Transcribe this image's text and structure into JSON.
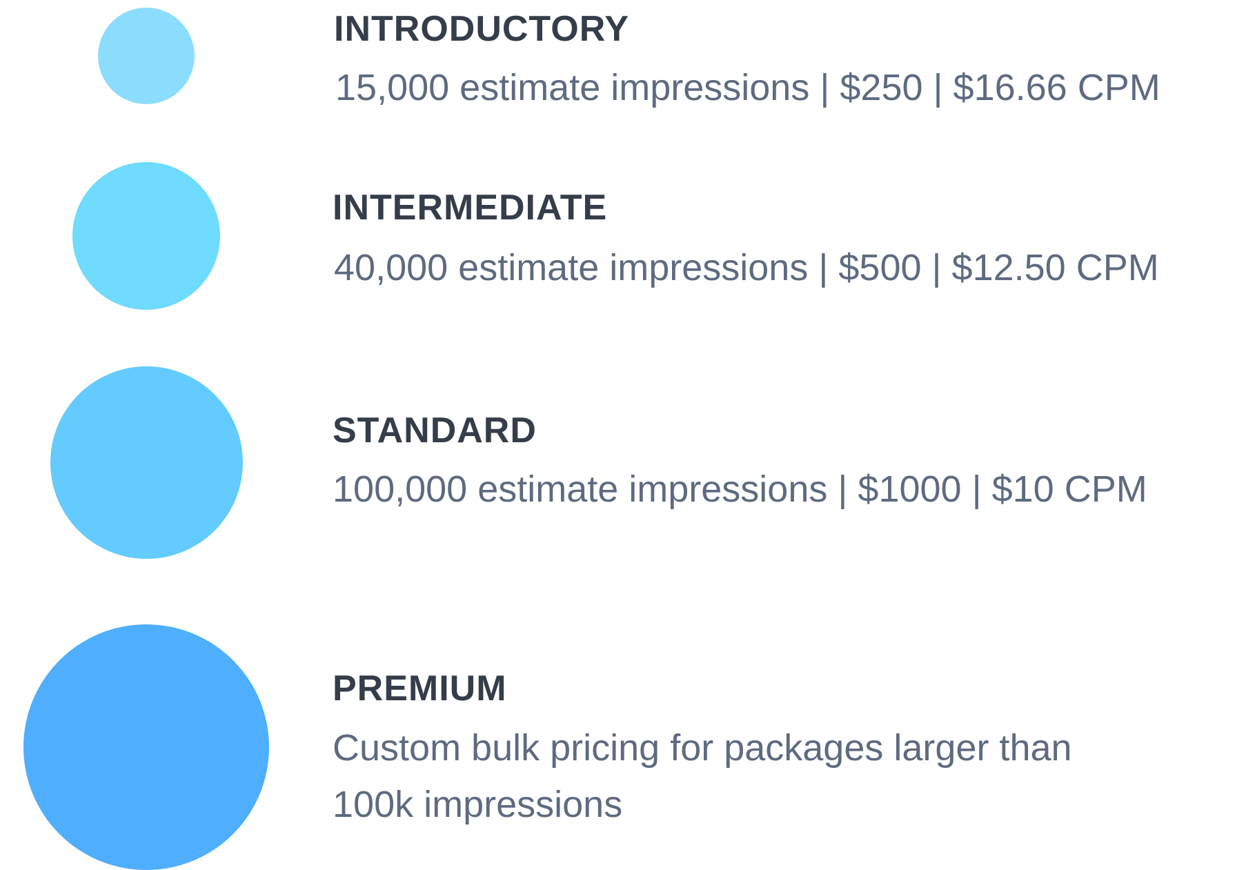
{
  "tiers": [
    {
      "title": "INTRODUCTORY",
      "description": "15,000 estimate impressions | $250 | $16.66 CPM",
      "color": "#8cdcfe"
    },
    {
      "title": "INTERMEDIATE",
      "description": "40,000 estimate impressions | $500 | $12.50 CPM",
      "color": "#6fdbfe"
    },
    {
      "title": "STANDARD",
      "description": "100,000 estimate impressions | $1000 | $10 CPM",
      "color": "#63cbfe"
    },
    {
      "title": "PREMIUM",
      "description": "Custom bulk pricing for packages larger than 100k impressions",
      "color": "#4faefe"
    }
  ]
}
